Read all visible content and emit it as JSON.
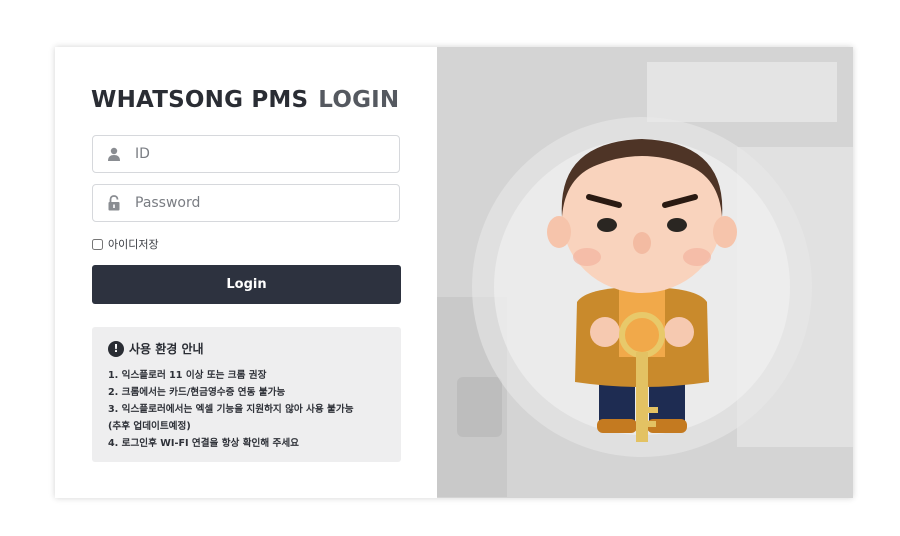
{
  "header": {
    "brand": "WHATSONG PMS",
    "subtitle": "LOGIN"
  },
  "form": {
    "id_placeholder": "ID",
    "password_placeholder": "Password",
    "remember_label": "아이디저장",
    "login_label": "Login"
  },
  "notice": {
    "title": "사용 환경 안내",
    "items": [
      "1. 익스플로러 11 이상 또는 크롬 권장",
      "2. 크롬에서는 카드/현금영수증 연동 불가능",
      "3. 익스플로러에서는 엑셀 기능을 지원하지 않아 사용 불가능",
      "(추후 업데이트예정)",
      "4. 로그인후 WI-FI 연결을 항상 확인해 주세요"
    ]
  },
  "icons": [
    "user-icon",
    "lock-icon",
    "exclamation-icon",
    "mascot-image"
  ],
  "colors": {
    "button": "#2d323f",
    "notice_bg": "#eeeeef",
    "right_panel": "#d9d9d9"
  }
}
